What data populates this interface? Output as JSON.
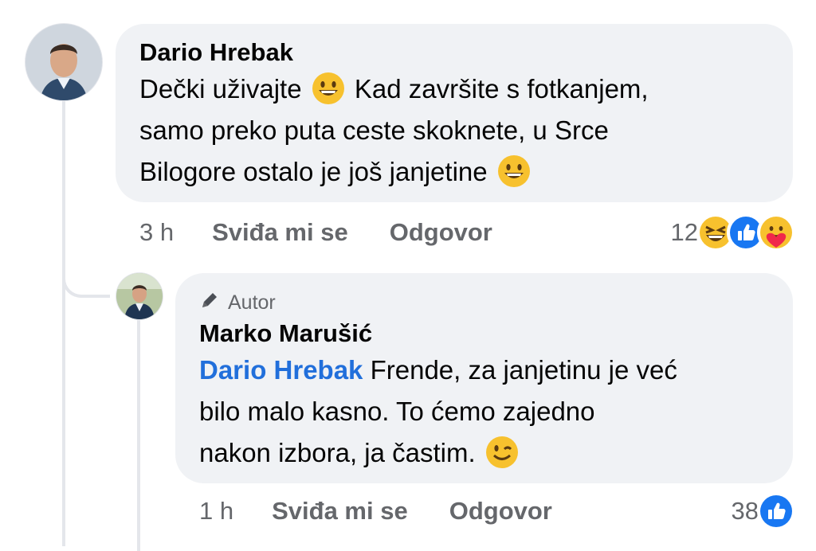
{
  "comment": {
    "author": "Dario Hrebak",
    "text_parts": [
      "Dečki uživajte",
      "Kad završite s fotkanjem,",
      "samo preko puta ceste skoknete, u Srce",
      "Bilogore ostalo je još janjetine"
    ],
    "time": "3 h",
    "like_label": "Sviđa mi se",
    "reply_label": "Odgovor",
    "reaction_count": "12",
    "reactions": [
      "laughing-emoji",
      "like-icon",
      "care-emoji"
    ]
  },
  "reply": {
    "badge_label": "Autor",
    "author": "Marko Marušić",
    "mention": "Dario Hrebak",
    "text_parts": [
      "Frende, za janjetinu je već",
      "bilo malo kasno. To ćemo zajedno",
      "nakon izbora, ja častim."
    ],
    "time": "1 h",
    "like_label": "Sviđa mi se",
    "reply_label": "Odgovor",
    "reaction_count": "38",
    "reactions": [
      "like-icon"
    ]
  },
  "colors": {
    "bubble": "#f0f2f5",
    "mention": "#216fdb",
    "meta": "#65676b",
    "like_blue": "#1877f2"
  }
}
